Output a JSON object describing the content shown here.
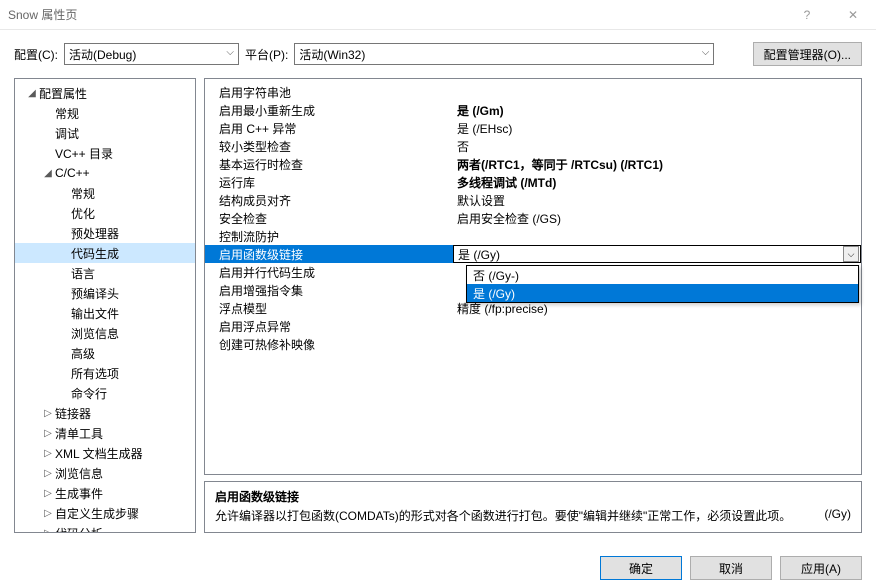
{
  "window": {
    "title": "Snow 属性页",
    "help": "?",
    "close": "✕"
  },
  "toprow": {
    "config_label": "配置(C):",
    "config_value": "活动(Debug)",
    "platform_label": "平台(P):",
    "platform_value": "活动(Win32)",
    "manager_button": "配置管理器(O)..."
  },
  "tree": [
    {
      "label": "配置属性",
      "depth": 1,
      "expander": "◢",
      "expanded": true
    },
    {
      "label": "常规",
      "depth": 2
    },
    {
      "label": "调试",
      "depth": 2
    },
    {
      "label": "VC++ 目录",
      "depth": 2
    },
    {
      "label": "C/C++",
      "depth": 2,
      "expander": "◢",
      "expanded": true
    },
    {
      "label": "常规",
      "depth": 3
    },
    {
      "label": "优化",
      "depth": 3
    },
    {
      "label": "预处理器",
      "depth": 3
    },
    {
      "label": "代码生成",
      "depth": 3,
      "selected": true
    },
    {
      "label": "语言",
      "depth": 3
    },
    {
      "label": "预编译头",
      "depth": 3
    },
    {
      "label": "输出文件",
      "depth": 3
    },
    {
      "label": "浏览信息",
      "depth": 3
    },
    {
      "label": "高级",
      "depth": 3
    },
    {
      "label": "所有选项",
      "depth": 3
    },
    {
      "label": "命令行",
      "depth": 3
    },
    {
      "label": "链接器",
      "depth": 2,
      "expander": "▷"
    },
    {
      "label": "清单工具",
      "depth": 2,
      "expander": "▷"
    },
    {
      "label": "XML 文档生成器",
      "depth": 2,
      "expander": "▷"
    },
    {
      "label": "浏览信息",
      "depth": 2,
      "expander": "▷"
    },
    {
      "label": "生成事件",
      "depth": 2,
      "expander": "▷"
    },
    {
      "label": "自定义生成步骤",
      "depth": 2,
      "expander": "▷"
    },
    {
      "label": "代码分析",
      "depth": 2,
      "expander": "▷"
    }
  ],
  "grid": [
    {
      "label": "启用字符串池",
      "value": ""
    },
    {
      "label": "启用最小重新生成",
      "value": "是 (/Gm)",
      "bold": true
    },
    {
      "label": "启用 C++ 异常",
      "value": "是 (/EHsc)"
    },
    {
      "label": "较小类型检查",
      "value": "否"
    },
    {
      "label": "基本运行时检查",
      "value": "两者(/RTC1，等同于 /RTCsu) (/RTC1)",
      "bold": true
    },
    {
      "label": "运行库",
      "value": "多线程调试 (/MTd)",
      "bold": true
    },
    {
      "label": "结构成员对齐",
      "value": "默认设置"
    },
    {
      "label": "安全检查",
      "value": "启用安全检查 (/GS)"
    },
    {
      "label": "控制流防护",
      "value": ""
    },
    {
      "label": "启用函数级链接",
      "value": "是 (/Gy)",
      "selected": true
    },
    {
      "label": "启用并行代码生成",
      "value": ""
    },
    {
      "label": "启用增强指令集",
      "value": ""
    },
    {
      "label": "浮点模型",
      "value": "精度 (/fp:precise)"
    },
    {
      "label": "启用浮点异常",
      "value": ""
    },
    {
      "label": "创建可热修补映像",
      "value": ""
    }
  ],
  "dropdown": {
    "options": [
      {
        "label": "否 (/Gy-)"
      },
      {
        "label": "是 (/Gy)",
        "highlight": true
      }
    ],
    "under_value": "精度 (/fp:precise)"
  },
  "desc": {
    "heading": "启用函数级链接",
    "body": "允许编译器以打包函数(COMDATs)的形式对各个函数进行打包。要使\"编辑并继续\"正常工作，必须设置此项。",
    "switch": "(/Gy)"
  },
  "buttons": {
    "ok": "确定",
    "cancel": "取消",
    "apply": "应用(A)"
  }
}
